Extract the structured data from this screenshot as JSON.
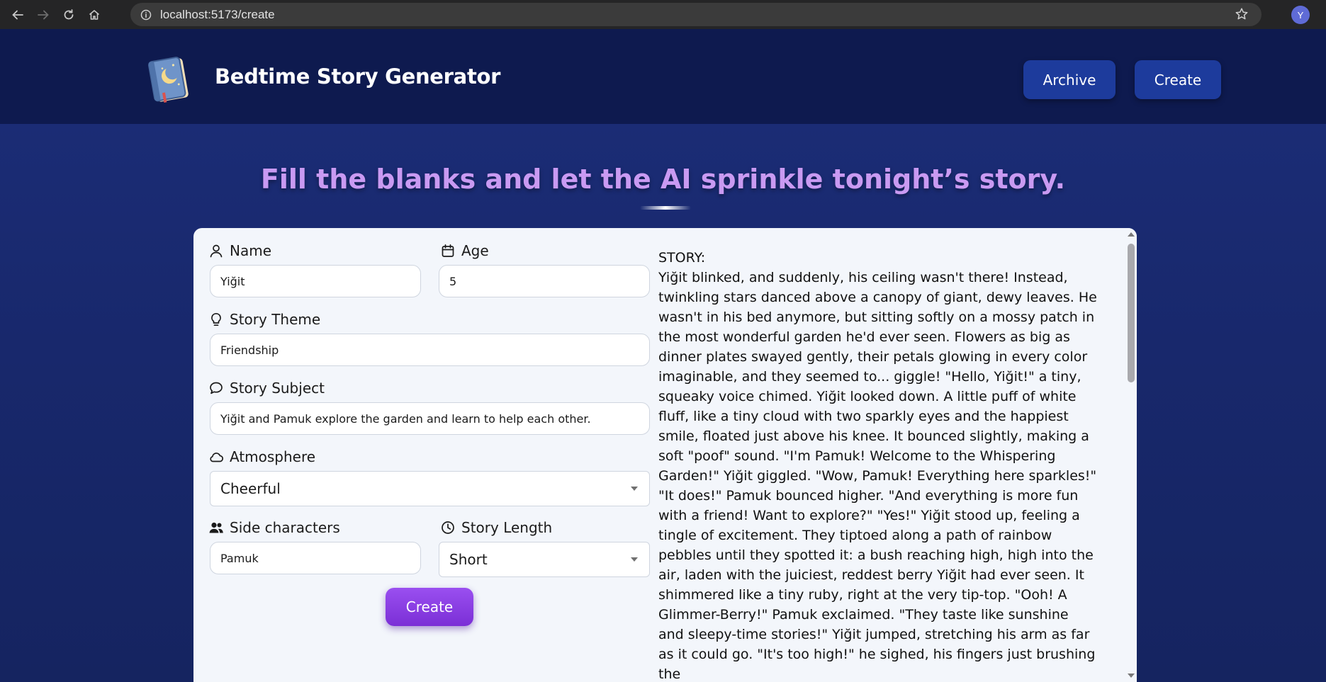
{
  "browser": {
    "url": "localhost:5173/create",
    "profile_initial": "Y"
  },
  "header": {
    "title": "Bedtime Story Generator",
    "archive_label": "Archive",
    "create_label": "Create"
  },
  "main": {
    "headline": "Fill the blanks and let the AI sprinkle tonight’s story."
  },
  "form": {
    "name": {
      "label": "Name",
      "value": "Yiğit"
    },
    "age": {
      "label": "Age",
      "value": "5"
    },
    "theme": {
      "label": "Story Theme",
      "value": "Friendship"
    },
    "subject": {
      "label": "Story Subject",
      "value": "Yiğit and Pamuk explore the garden and learn to help each other."
    },
    "atmosphere": {
      "label": "Atmosphere",
      "value": "Cheerful"
    },
    "side_characters": {
      "label": "Side characters",
      "value": "Pamuk"
    },
    "length": {
      "label": "Story Length",
      "value": "Short"
    },
    "submit_label": "Create"
  },
  "story": {
    "heading": "STORY:",
    "text": "Yiğit blinked, and suddenly, his ceiling wasn't there! Instead, twinkling stars danced above a canopy of giant, dewy leaves. He wasn't in his bed anymore, but sitting softly on a mossy patch in the most wonderful garden he'd ever seen. Flowers as big as dinner plates swayed gently, their petals glowing in every color imaginable, and they seemed to... giggle! \"Hello, Yiğit!\" a tiny, squeaky voice chimed. Yiğit looked down. A little puff of white fluff, like a tiny cloud with two sparkly eyes and the happiest smile, floated just above his knee. It bounced slightly, making a soft \"poof\" sound. \"I'm Pamuk! Welcome to the Whispering Garden!\" Yiğit giggled. \"Wow, Pamuk! Everything here sparkles!\" \"It does!\" Pamuk bounced higher. \"And everything is more fun with a friend! Want to explore?\" \"Yes!\" Yiğit stood up, feeling a tingle of excitement. They tiptoed along a path of rainbow pebbles until they spotted it: a bush reaching high, high into the air, laden with the juiciest, reddest berry Yiğit had ever seen. It shimmered like a tiny ruby, right at the very tip-top. \"Ooh! A Glimmer-Berry!\" Pamuk exclaimed. \"They taste like sunshine and sleepy-time stories!\" Yiğit jumped, stretching his arm as far as it could go. \"It's too high!\" he sighed, his fingers just brushing the"
  },
  "colors": {
    "header_bg": "#0e1a4f",
    "headline": "#c99af2",
    "nav_button": "#1d3b9c",
    "create_button": "#8a3fe6"
  }
}
